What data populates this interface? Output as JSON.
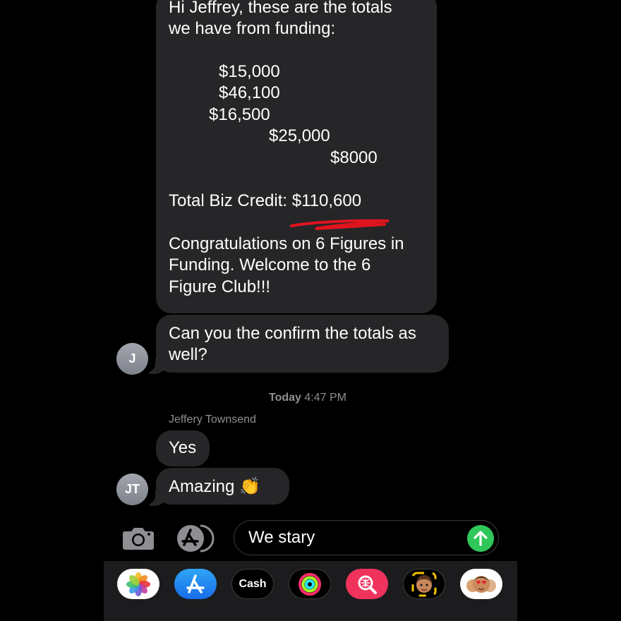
{
  "conversation": {
    "funding_message": {
      "greeting": [
        "Hi Jeffrey, these are the totals",
        "we have from funding:"
      ],
      "amounts": [
        "$15,000",
        "$46,100",
        "$16,500",
        "$25,000",
        "$8000"
      ],
      "total_label": "Total Biz Credit:",
      "total_value": "$110,600",
      "closing": [
        "Congratulations on 6 Figures in",
        "Funding. Welcome to the 6",
        "Figure Club!!!"
      ]
    },
    "confirm_message": [
      "Can you the confirm the totals as",
      "well?"
    ],
    "sender_avatar_initial": "J",
    "timestamp": {
      "day": "Today",
      "time": "4:47 PM"
    },
    "sender_name": "Jeffery Townsend",
    "reply_yes": "Yes",
    "reply_amazing": "Amazing",
    "reply_emoji": "👏",
    "reply_avatar_initials": "JT"
  },
  "composer": {
    "text": "We stary"
  },
  "app_tray": {
    "cash_label": "Cash",
    "cash_symbol": ""
  },
  "colors": {
    "background": "#000000",
    "bubble": "#262628",
    "send_button": "#30c75a",
    "highlight_underline": "#e0141e"
  },
  "icons": [
    "camera-icon",
    "app-store-icon",
    "send-arrow-icon",
    "photos-app-icon",
    "app-store-app-icon",
    "apple-cash-icon",
    "activity-rings-icon",
    "image-search-icon",
    "memoji-icon",
    "memoji-stickers-icon"
  ]
}
